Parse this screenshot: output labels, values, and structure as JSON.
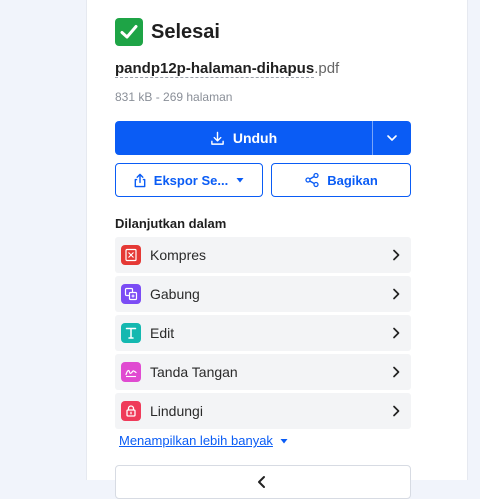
{
  "status": {
    "text": "Selesai"
  },
  "file": {
    "name": "pandp12p-halaman-dihapus",
    "ext": ".pdf",
    "meta": "831 kB - 269 halaman"
  },
  "actions": {
    "download_label": "Unduh",
    "export_label": "Ekspor Se...",
    "share_label": "Bagikan"
  },
  "continue": {
    "title": "Dilanjutkan dalam",
    "items": [
      {
        "label": "Kompres",
        "icon": "compress-icon",
        "color": "#e53935"
      },
      {
        "label": "Gabung",
        "icon": "merge-icon",
        "color": "#7b4cf5"
      },
      {
        "label": "Edit",
        "icon": "edit-icon",
        "color": "#14b8b0"
      },
      {
        "label": "Tanda Tangan",
        "icon": "sign-icon",
        "color": "#e04bd1"
      },
      {
        "label": "Lindungi",
        "icon": "lock-icon",
        "color": "#ef3b5a"
      }
    ],
    "show_more": "Menampilkan lebih banyak"
  },
  "colors": {
    "primary": "#0a5cf5",
    "success": "#1ea446",
    "page_bg": "#f1f4fb"
  }
}
